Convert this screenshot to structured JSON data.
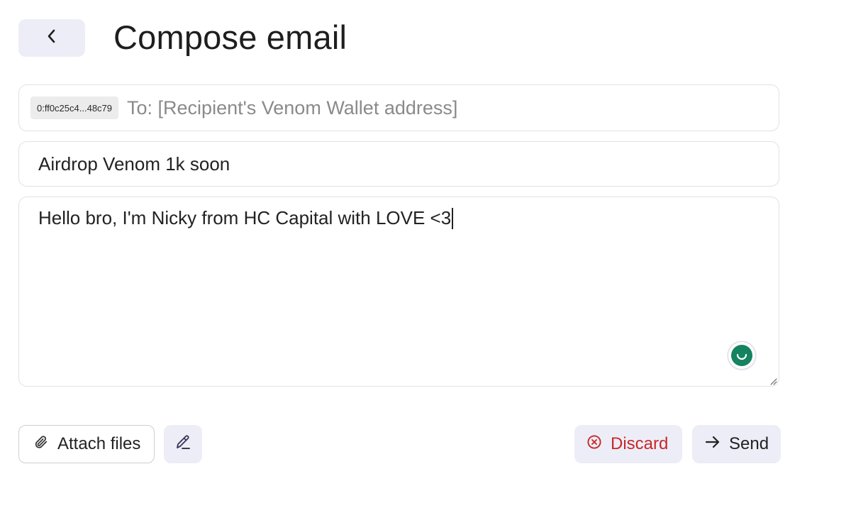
{
  "header": {
    "back_icon": "chevron-left-icon",
    "title": "Compose email"
  },
  "form": {
    "recipient_chip": "0:ff0c25c4...48c79",
    "to_placeholder": "To: [Recipient's Venom Wallet address]",
    "subject": "Airdrop Venom 1k soon",
    "body": "Hello bro, I'm Nicky from HC Capital with LOVE <3"
  },
  "actions": {
    "attach_label": "Attach files",
    "discard_label": "Discard",
    "send_label": "Send"
  },
  "colors": {
    "accent_bg": "#ededf8",
    "discard": "#c62828",
    "grammar_badge": "#15835f"
  }
}
